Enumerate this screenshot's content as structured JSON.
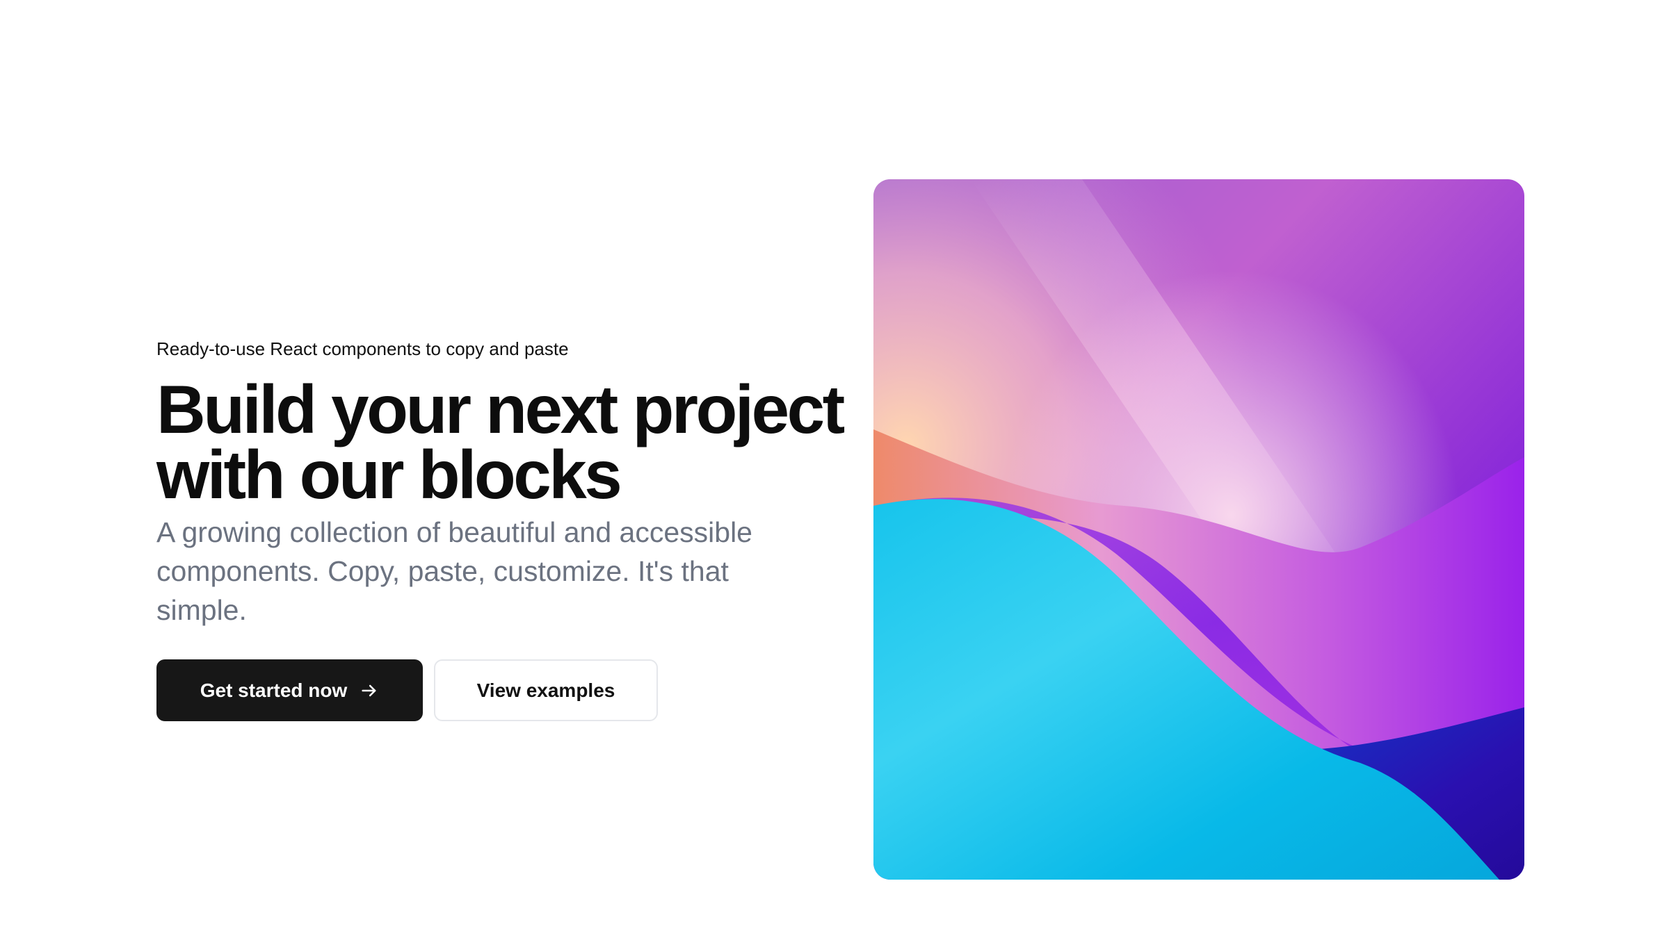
{
  "hero": {
    "eyebrow": "Ready-to-use React components to copy and paste",
    "headline_line1": "Build your next project",
    "headline_line2": "with our blocks",
    "subtitle": "A growing collection of beautiful and accessible components. Copy, paste, customize. It's that simple."
  },
  "cta": {
    "primary_label": "Get started now",
    "primary_icon": "arrow-right-icon",
    "secondary_label": "View examples"
  },
  "colors": {
    "primary_button_bg": "#171717",
    "headline": "#0d0d0d",
    "subtitle": "#6b7280",
    "secondary_button_border": "#e5e7eb"
  },
  "art": {
    "icon": "abstract-gradient-wave-image",
    "palette": [
      "#7b3fc9",
      "#c74fd1",
      "#f7c9b0",
      "#e98a6a",
      "#a020f0",
      "#2b0fa6",
      "#00c2e8",
      "#35d0f0"
    ]
  }
}
